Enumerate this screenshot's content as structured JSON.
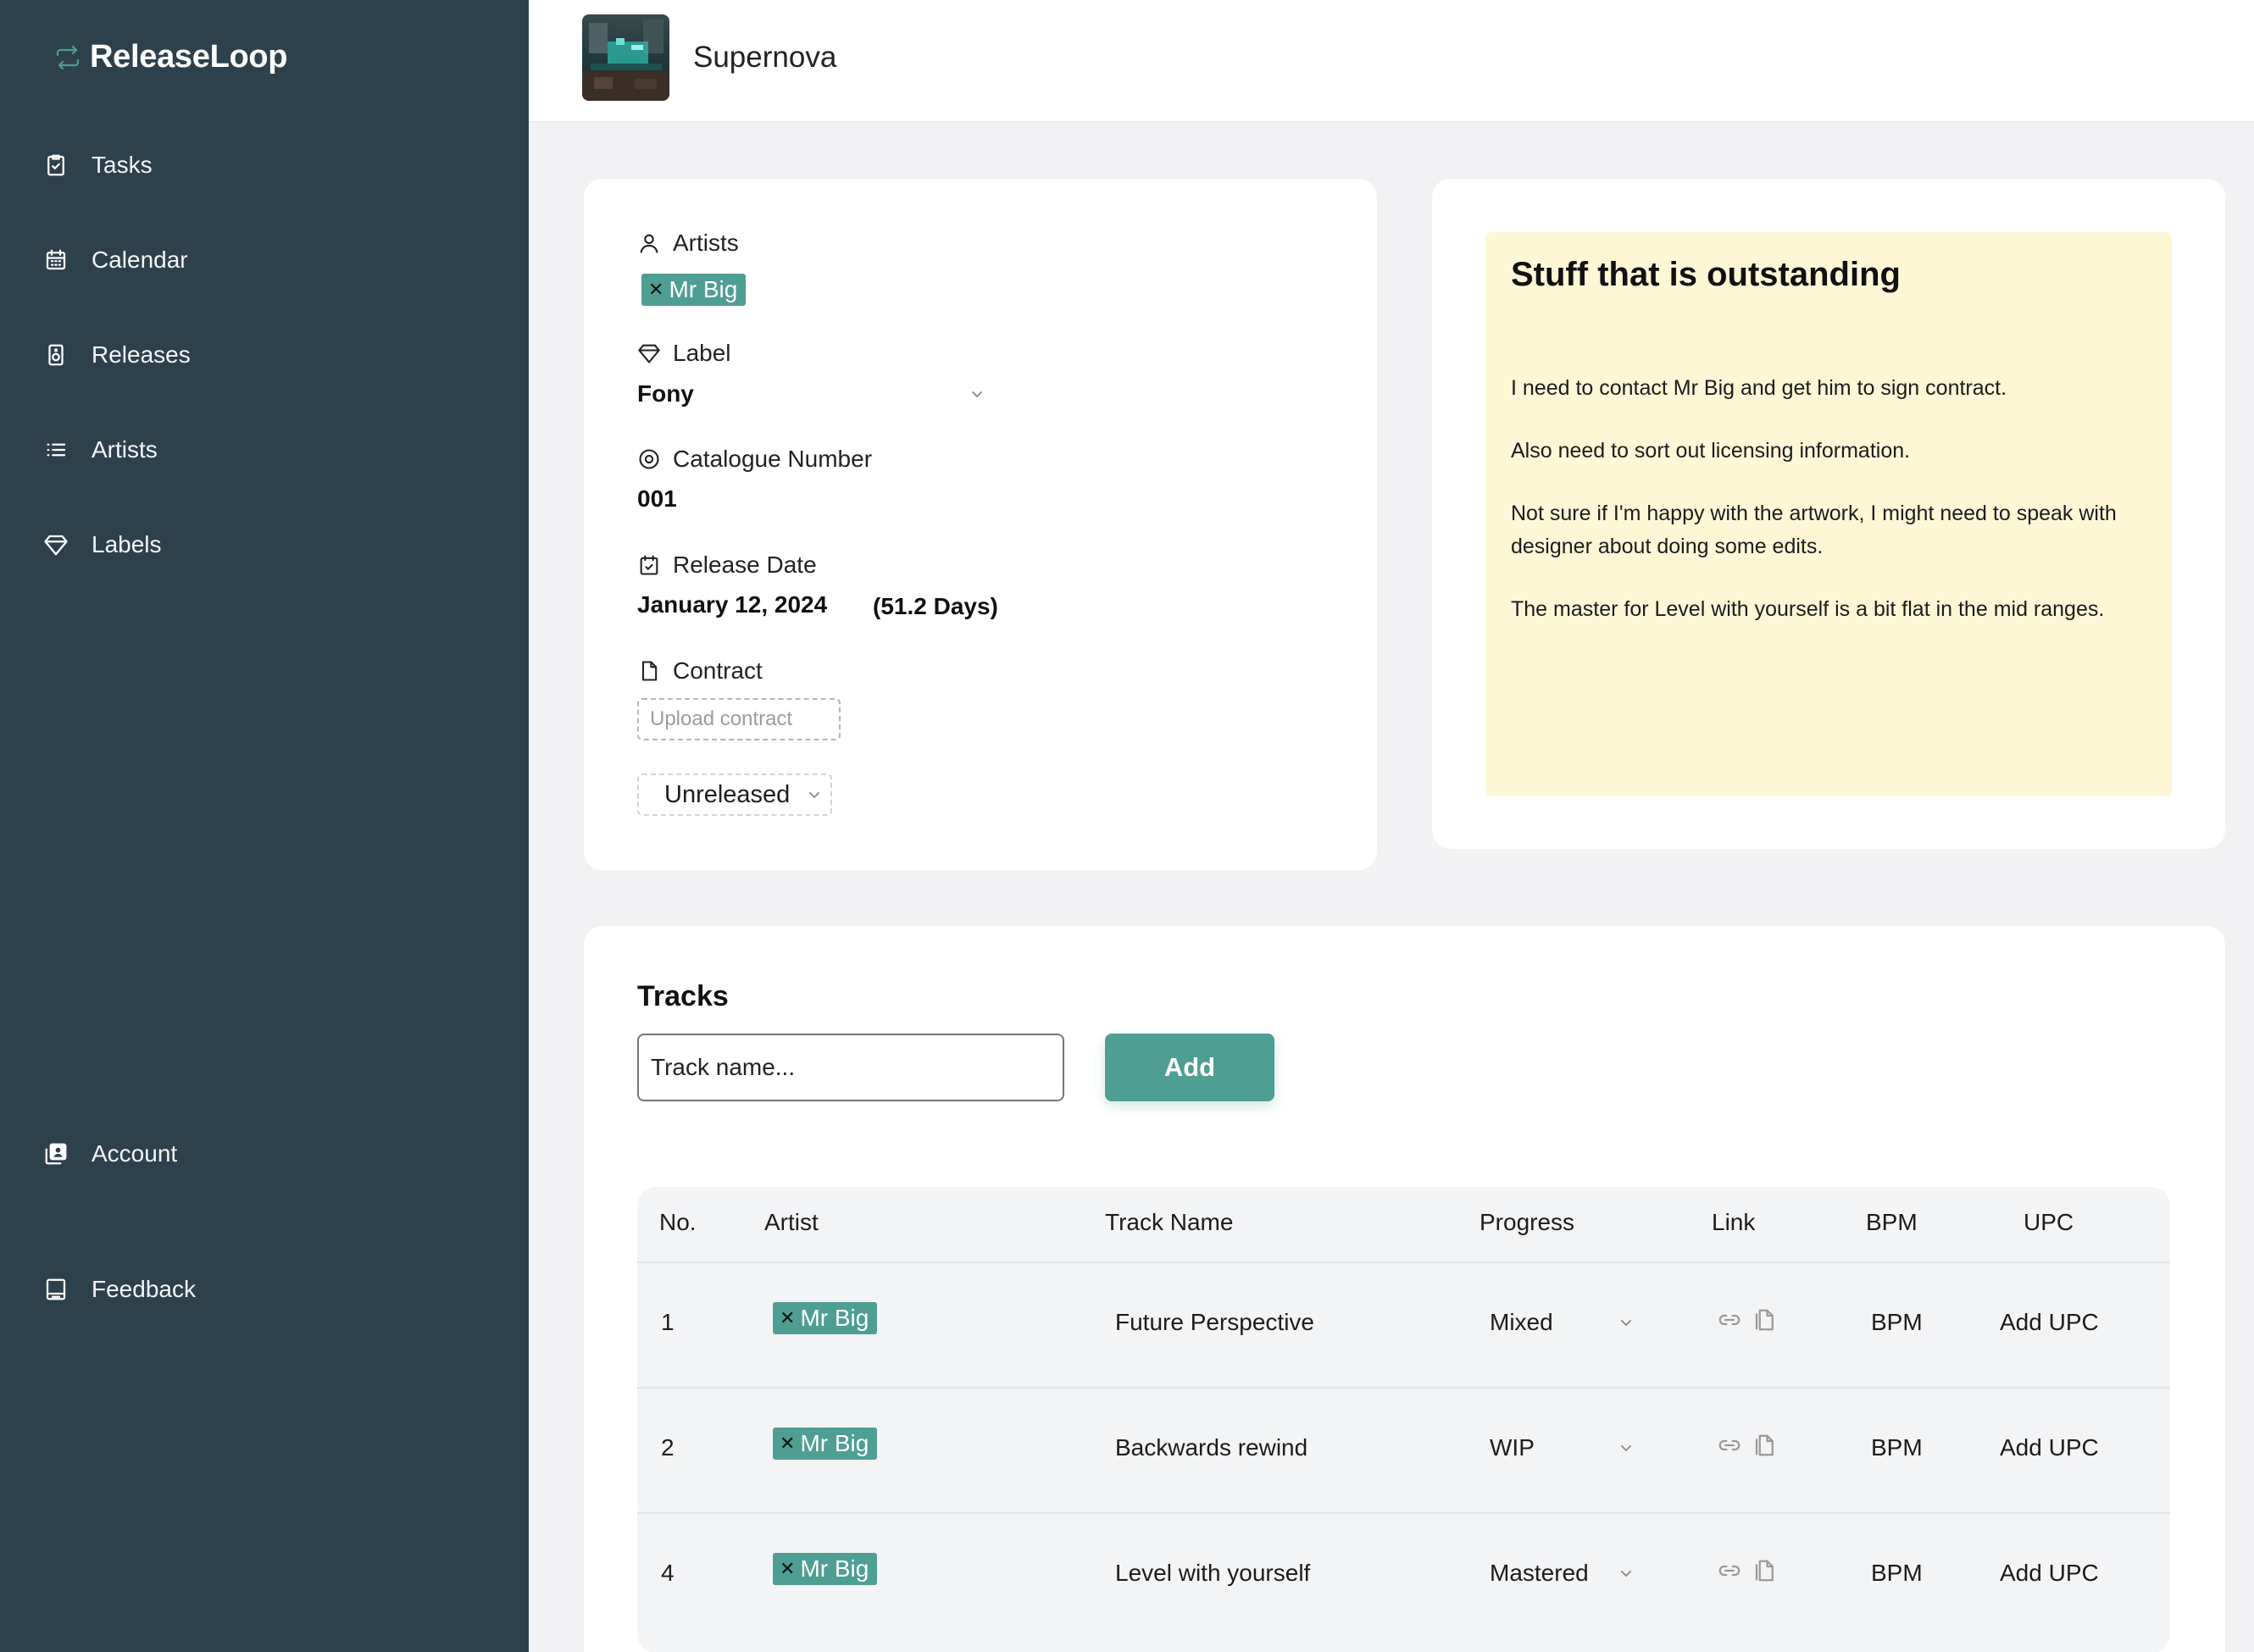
{
  "brand": {
    "name": "ReleaseLoop",
    "accent": "#4f9e93",
    "sidebar_bg": "#2d414d"
  },
  "sidebar": {
    "items": [
      {
        "label": "Tasks",
        "icon": "clipboard-check-icon"
      },
      {
        "label": "Calendar",
        "icon": "calendar-icon"
      },
      {
        "label": "Releases",
        "icon": "speaker-icon"
      },
      {
        "label": "Artists",
        "icon": "list-icon"
      },
      {
        "label": "Labels",
        "icon": "diamond-icon"
      }
    ],
    "bottom_items": [
      {
        "label": "Account",
        "icon": "account-icon"
      },
      {
        "label": "Feedback",
        "icon": "feedback-icon"
      }
    ]
  },
  "header": {
    "release_title": "Supernova"
  },
  "details": {
    "artists_label": "Artists",
    "artist_tag": "Mr Big",
    "label_label": "Label",
    "label_value": "Fony",
    "catalogue_label": "Catalogue Number",
    "catalogue_value": "001",
    "release_date_label": "Release Date",
    "release_date_value": "January 12, 2024",
    "release_date_countdown": "(51.2 Days)",
    "contract_label": "Contract",
    "upload_label": "Upload contract",
    "status_value": "Unreleased"
  },
  "notes": {
    "title": "Stuff that is outstanding",
    "paragraphs": [
      "I need to contact Mr Big and get him to sign contract.",
      "Also need to sort out licensing information.",
      "Not sure if I'm happy with the artwork, I might need to speak with designer about doing some edits.",
      "The master for Level with yourself is a bit flat in the mid ranges."
    ],
    "note_bg": "#fdf7d6"
  },
  "tracks": {
    "title": "Tracks",
    "input_placeholder": "Track name...",
    "add_label": "Add",
    "columns": {
      "no": "No.",
      "artist": "Artist",
      "name": "Track Name",
      "progress": "Progress",
      "link": "Link",
      "bpm": "BPM",
      "upc": "UPC"
    },
    "rows": [
      {
        "no": "1",
        "artist": "Mr Big",
        "name": "Future Perspective",
        "progress": "Mixed",
        "bpm": "BPM",
        "upc": "Add UPC"
      },
      {
        "no": "2",
        "artist": "Mr Big",
        "name": "Backwards rewind",
        "progress": "WIP",
        "bpm": "BPM",
        "upc": "Add UPC"
      },
      {
        "no": "4",
        "artist": "Mr Big",
        "name": "Level with yourself",
        "progress": "Mastered",
        "bpm": "BPM",
        "upc": "Add UPC"
      }
    ]
  }
}
